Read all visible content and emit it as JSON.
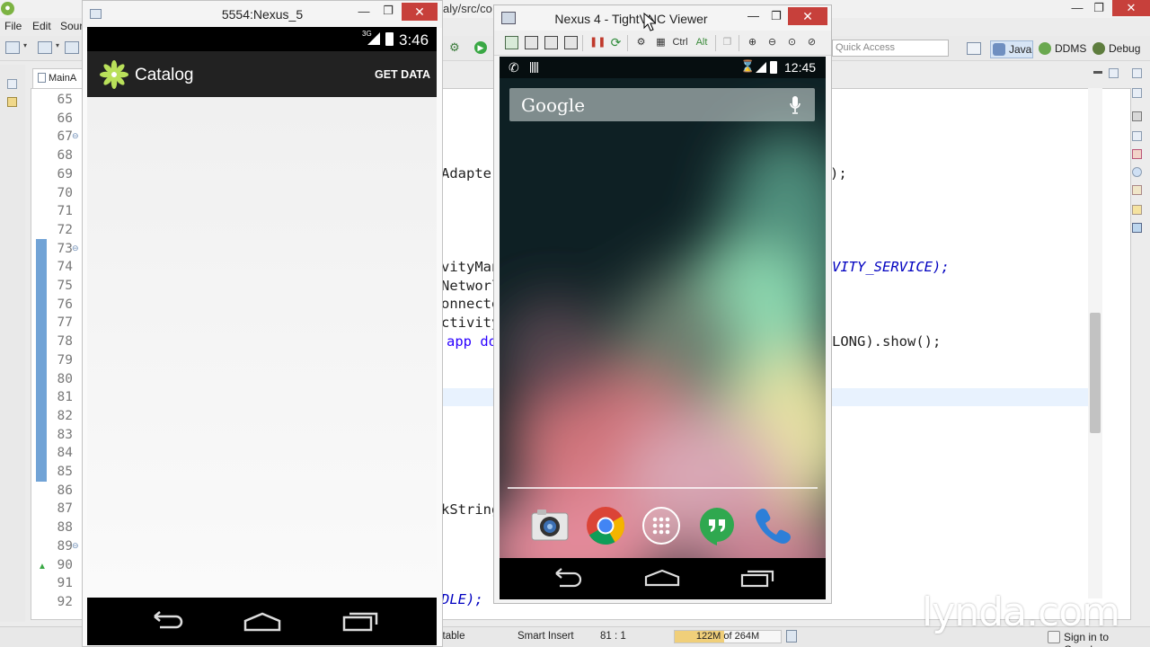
{
  "ide": {
    "title_path": "aly/src/co",
    "menu": [
      "File",
      "Edit",
      "Sour"
    ],
    "quick_access_placeholder": "Quick Access",
    "perspectives": [
      "Java",
      "DDMS",
      "Debug"
    ],
    "editor_tab": "MainA",
    "line_numbers": [
      "65",
      "66",
      "67",
      "68",
      "69",
      "70",
      "71",
      "72",
      "73",
      "74",
      "75",
      "76",
      "77",
      "78",
      "79",
      "80",
      "81",
      "82",
      "83",
      "84",
      "85",
      "86",
      "87",
      "88",
      "89",
      "90",
      "91",
      "92"
    ],
    "code_fragments": {
      "adapter_left": "Adapter",
      "adapter_right": ");",
      "activity_manager": "vityMan",
      "activity_service": "VITY_SERVICE);",
      "network": "Networl",
      "connected": "onnecte",
      "activity": "ctivity",
      "app_does": "app do",
      "long_show": "LONG).show();",
      "kstring": "kString",
      "trailing": "DLE);"
    },
    "status": {
      "writable": "itable",
      "insert_mode": "Smart Insert",
      "position": "81 : 1",
      "heap": "122M of 264M",
      "heap_fraction": 0.462,
      "sign_in": "Sign in to Google..."
    }
  },
  "emulator": {
    "title": "5554:Nexus_5",
    "status_time": "3:46",
    "network_type": "3G",
    "app_title": "Catalog",
    "action_get_data": "GET DATA"
  },
  "vnc": {
    "title": "Nexus 4 - TightVNC Viewer",
    "toolbar_ctrl": "Ctrl",
    "toolbar_alt": "Alt",
    "phone": {
      "status_time": "12:45",
      "search_label": "Google",
      "dock_apps": [
        "camera-app-icon",
        "chrome-app-icon",
        "apps-launcher-icon",
        "hangouts-app-icon",
        "phone-app-icon"
      ]
    }
  },
  "watermark": "lynda.com"
}
